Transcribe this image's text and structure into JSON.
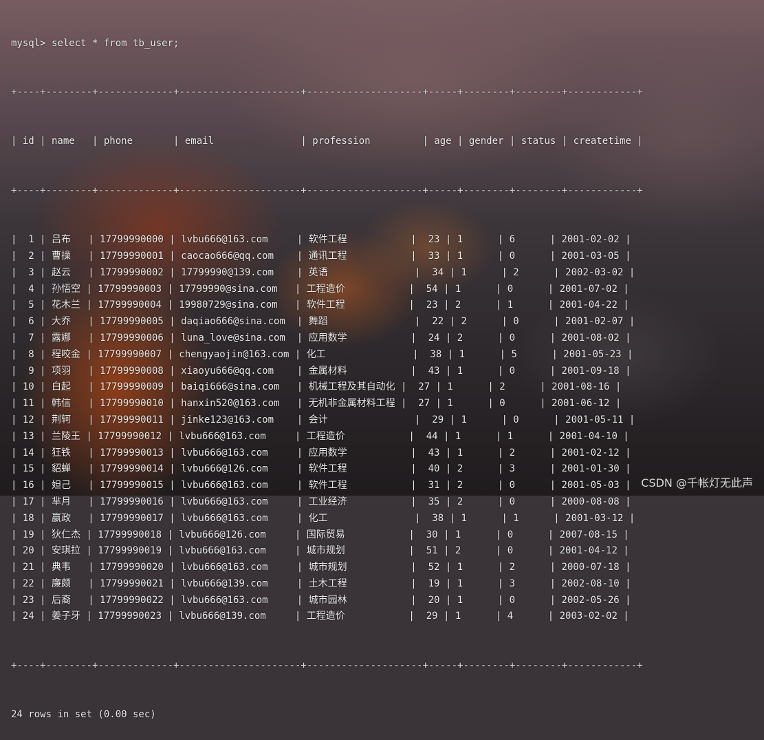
{
  "terminal": {
    "prompt": "mysql>",
    "command": "select * from tb_user;",
    "columns": [
      "id",
      "name",
      "phone",
      "email",
      "profession",
      "age",
      "gender",
      "status",
      "createtime"
    ],
    "rows": [
      [
        "1",
        "吕布",
        "17799990000",
        "lvbu666@163.com",
        "软件工程",
        "23",
        "1",
        "6",
        "2001-02-02"
      ],
      [
        "2",
        "曹操",
        "17799990001",
        "caocao666@qq.com",
        "通讯工程",
        "33",
        "1",
        "0",
        "2001-03-05"
      ],
      [
        "3",
        "赵云",
        "17799990002",
        "17799990@139.com",
        "英语",
        "34",
        "1",
        "2",
        "2002-03-02"
      ],
      [
        "4",
        "孙悟空",
        "17799990003",
        "17799990@sina.com",
        "工程造价",
        "54",
        "1",
        "0",
        "2001-07-02"
      ],
      [
        "5",
        "花木兰",
        "17799990004",
        "19980729@sina.com",
        "软件工程",
        "23",
        "2",
        "1",
        "2001-04-22"
      ],
      [
        "6",
        "大乔",
        "17799990005",
        "daqiao666@sina.com",
        "舞蹈",
        "22",
        "2",
        "0",
        "2001-02-07"
      ],
      [
        "7",
        "露娜",
        "17799990006",
        "luna_love@sina.com",
        "应用数学",
        "24",
        "2",
        "0",
        "2001-08-02"
      ],
      [
        "8",
        "程咬金",
        "17799990007",
        "chengyaojin@163.com",
        "化工",
        "38",
        "1",
        "5",
        "2001-05-23"
      ],
      [
        "9",
        "项羽",
        "17799990008",
        "xiaoyu666@qq.com",
        "金属材料",
        "43",
        "1",
        "0",
        "2001-09-18"
      ],
      [
        "10",
        "白起",
        "17799990009",
        "baiqi666@sina.com",
        "机械工程及其自动化",
        "27",
        "1",
        "2",
        "2001-08-16"
      ],
      [
        "11",
        "韩信",
        "17799990010",
        "hanxin520@163.com",
        "无机非金属材料工程",
        "27",
        "1",
        "0",
        "2001-06-12"
      ],
      [
        "12",
        "荆轲",
        "17799990011",
        "jinke123@163.com",
        "会计",
        "29",
        "1",
        "0",
        "2001-05-11"
      ],
      [
        "13",
        "兰陵王",
        "17799990012",
        "lvbu666@163.com",
        "工程造价",
        "44",
        "1",
        "1",
        "2001-04-10"
      ],
      [
        "14",
        "狂铁",
        "17799990013",
        "lvbu666@163.com",
        "应用数学",
        "43",
        "1",
        "2",
        "2001-02-12"
      ],
      [
        "15",
        "貂蝉",
        "17799990014",
        "lvbu666@126.com",
        "软件工程",
        "40",
        "2",
        "3",
        "2001-01-30"
      ],
      [
        "16",
        "妲己",
        "17799990015",
        "lvbu666@163.com",
        "软件工程",
        "31",
        "2",
        "0",
        "2001-05-03"
      ],
      [
        "17",
        "芈月",
        "17799990016",
        "lvbu666@163.com",
        "工业经济",
        "35",
        "2",
        "0",
        "2000-08-08"
      ],
      [
        "18",
        "嬴政",
        "17799990017",
        "lvbu666@163.com",
        "化工",
        "38",
        "1",
        "1",
        "2001-03-12"
      ],
      [
        "19",
        "狄仁杰",
        "17799990018",
        "lvbu666@126.com",
        "国际贸易",
        "30",
        "1",
        "0",
        "2007-08-15"
      ],
      [
        "20",
        "安琪拉",
        "17799990019",
        "lvbu666@163.com",
        "城市规划",
        "51",
        "2",
        "0",
        "2001-04-12"
      ],
      [
        "21",
        "典韦",
        "17799990020",
        "lvbu666@163.com",
        "城市规划",
        "52",
        "1",
        "2",
        "2000-07-18"
      ],
      [
        "22",
        "廉颇",
        "17799990021",
        "lvbu666@139.com",
        "土木工程",
        "19",
        "1",
        "3",
        "2002-08-10"
      ],
      [
        "23",
        "后裔",
        "17799990022",
        "lvbu666@163.com",
        "城市园林",
        "20",
        "1",
        "0",
        "2002-05-26"
      ],
      [
        "24",
        "姜子牙",
        "17799990023",
        "lvbu666@139.com",
        "工程造价",
        "29",
        "1",
        "4",
        "2003-02-02"
      ]
    ],
    "footer": "24 rows in set (0.00 sec)"
  },
  "watermark": "CSDN @千帐灯无此声"
}
